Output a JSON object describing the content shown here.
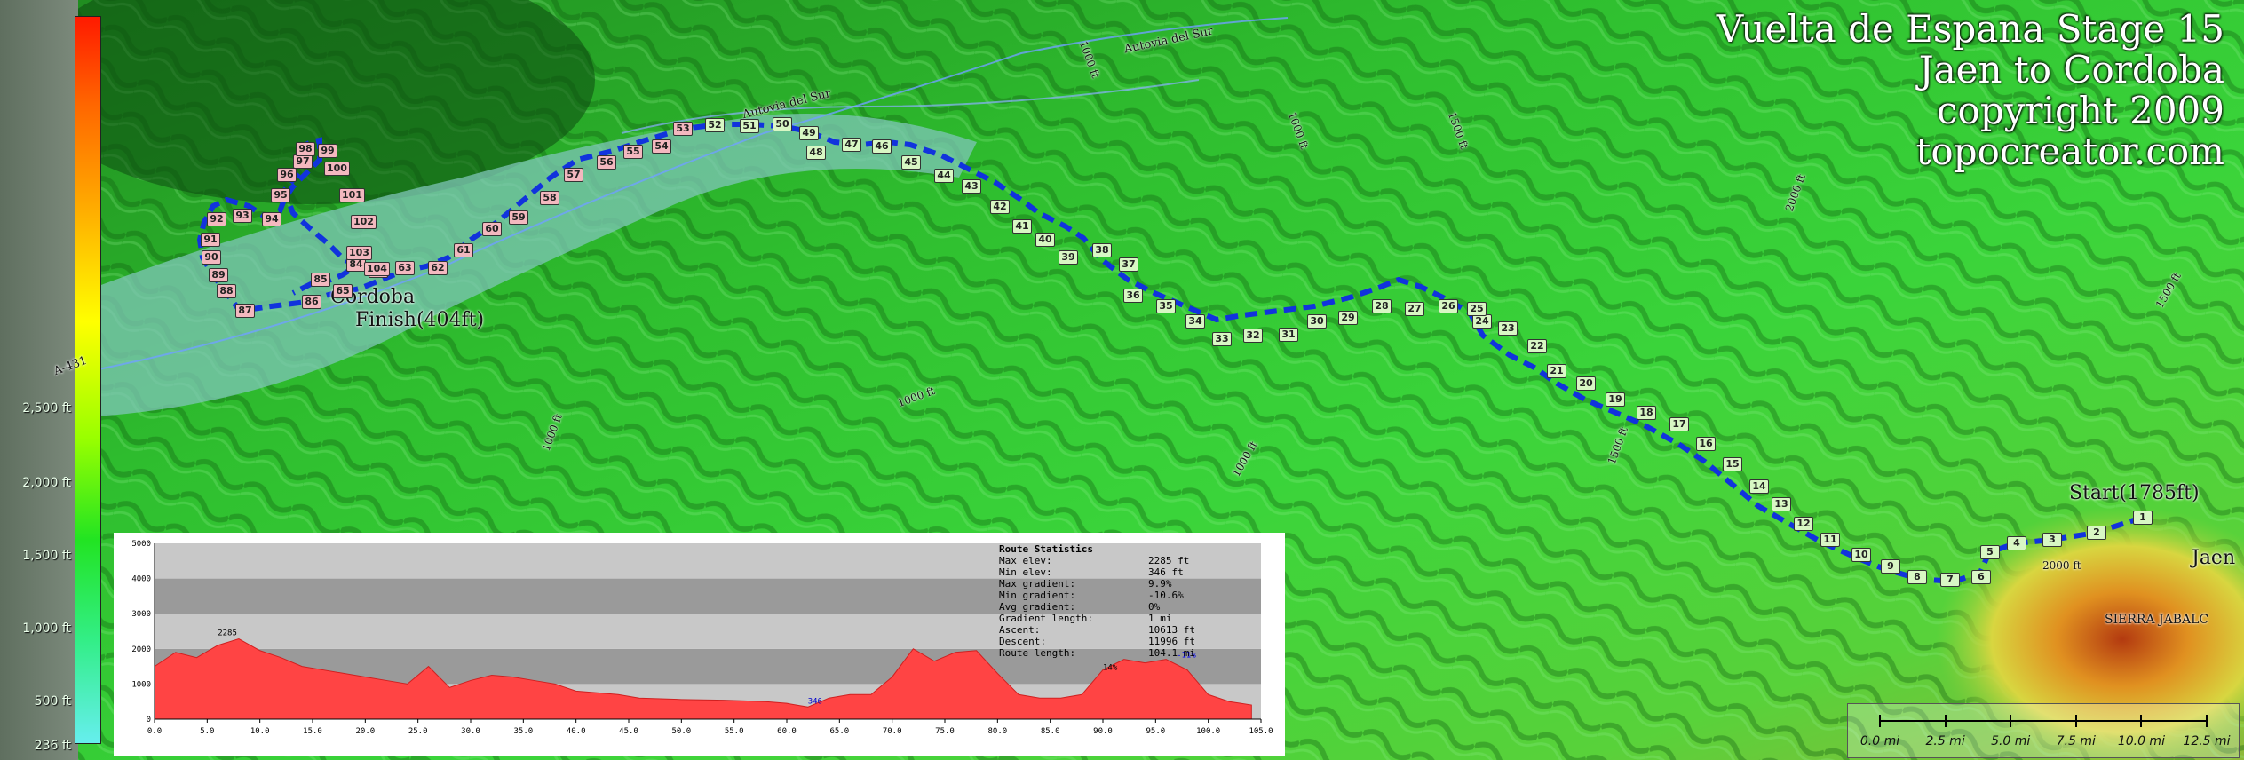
{
  "title": {
    "line1": "Vuelta de Espana Stage 15",
    "line2": "Jaen to Cordoba",
    "line3": "copyright 2009",
    "line4": "topocreator.com"
  },
  "legend": {
    "ticks": [
      "2,500 ft",
      "2,000 ft",
      "1,500 ft",
      "1,000 ft",
      "500 ft",
      "236 ft"
    ]
  },
  "places": {
    "start": "Start(1785ft)",
    "finish_city": "Cordoba",
    "finish": "Finish(404ft)",
    "jaen": "Jaen",
    "sierra": "SIERRA JABALC",
    "road1": "Autovia del Sur",
    "road2": "Autovia del Sur",
    "road3": "A-431"
  },
  "contours": [
    "1000 ft",
    "1000 ft",
    "1500 ft",
    "1000 ft",
    "1500 ft",
    "1000 ft",
    "2000 ft",
    "1500 ft",
    "1000 ft",
    "2000 ft"
  ],
  "route": {
    "markers": [
      "1",
      "2",
      "3",
      "4",
      "5",
      "6",
      "7",
      "8",
      "9",
      "10",
      "11",
      "12",
      "13",
      "14",
      "15",
      "16",
      "17",
      "18",
      "19",
      "20",
      "21",
      "22",
      "23",
      "24",
      "25",
      "26",
      "27",
      "28",
      "29",
      "30",
      "31",
      "32",
      "33",
      "34",
      "35",
      "36",
      "37",
      "38",
      "39",
      "40",
      "41",
      "42",
      "43",
      "44",
      "45",
      "46",
      "47",
      "48",
      "49",
      "50",
      "51",
      "52",
      "53",
      "54",
      "55",
      "56",
      "57",
      "58",
      "59",
      "60",
      "61",
      "62",
      "63",
      "64",
      "65",
      "84",
      "85",
      "86",
      "87",
      "88",
      "89",
      "90",
      "91",
      "92",
      "93",
      "94",
      "95",
      "96",
      "97",
      "98",
      "99",
      "100",
      "101",
      "102",
      "103",
      "104"
    ]
  },
  "profile": {
    "chart_data": {
      "type": "area",
      "x": [
        0,
        2,
        4,
        6,
        8,
        10,
        12,
        14,
        16,
        18,
        20,
        22,
        24,
        26,
        28,
        30,
        32,
        34,
        36,
        38,
        40,
        42,
        44,
        46,
        48,
        50,
        52,
        54,
        56,
        58,
        60,
        62,
        64,
        66,
        68,
        70,
        72,
        74,
        76,
        78,
        80,
        82,
        84,
        86,
        88,
        90,
        92,
        94,
        96,
        98,
        100,
        102,
        104.1
      ],
      "y": [
        1500,
        1900,
        1750,
        2100,
        2285,
        1950,
        1750,
        1500,
        1400,
        1300,
        1200,
        1100,
        1000,
        1500,
        900,
        1100,
        1250,
        1200,
        1100,
        1000,
        800,
        750,
        700,
        600,
        580,
        560,
        550,
        540,
        520,
        500,
        450,
        346,
        600,
        700,
        700,
        1200,
        2000,
        1650,
        1900,
        1950,
        1300,
        700,
        600,
        600,
        700,
        1400,
        1700,
        1600,
        1700,
        1400,
        700,
        500,
        404
      ],
      "xlim": [
        0,
        105
      ],
      "ylim": [
        0,
        5000
      ],
      "xticks": [
        "0.0",
        "5.0",
        "10.0",
        "15.0",
        "20.0",
        "25.0",
        "30.0",
        "35.0",
        "40.0",
        "45.0",
        "50.0",
        "55.0",
        "60.0",
        "65.0",
        "70.0",
        "75.0",
        "80.0",
        "85.0",
        "90.0",
        "95.0",
        "100.0",
        "105.0"
      ],
      "yticks": [
        "0",
        "1000",
        "2000",
        "3000",
        "4000",
        "5000"
      ],
      "annotations": [
        "2285",
        "346",
        "14%",
        "-11%"
      ],
      "fill_color": "#ff4444"
    },
    "stats": {
      "heading": "Route Statistics",
      "rows": [
        {
          "label": "Max elev:",
          "value": "2285 ft"
        },
        {
          "label": "Min elev:",
          "value": "346 ft"
        },
        {
          "label": "Max gradient:",
          "value": "9.9%"
        },
        {
          "label": "Min gradient:",
          "value": "-10.6%"
        },
        {
          "label": "Avg gradient:",
          "value": "0%"
        },
        {
          "label": "Gradient length:",
          "value": "1 mi"
        },
        {
          "label": "Ascent:",
          "value": "10613 ft"
        },
        {
          "label": "Descent:",
          "value": "11996 ft"
        },
        {
          "label": "Route length:",
          "value": "104.1 mi"
        }
      ]
    }
  },
  "scale": {
    "labels": [
      "0.0 mi",
      "2.5 mi",
      "5.0 mi",
      "7.5 mi",
      "10.0 mi",
      "12.5 mi"
    ]
  }
}
